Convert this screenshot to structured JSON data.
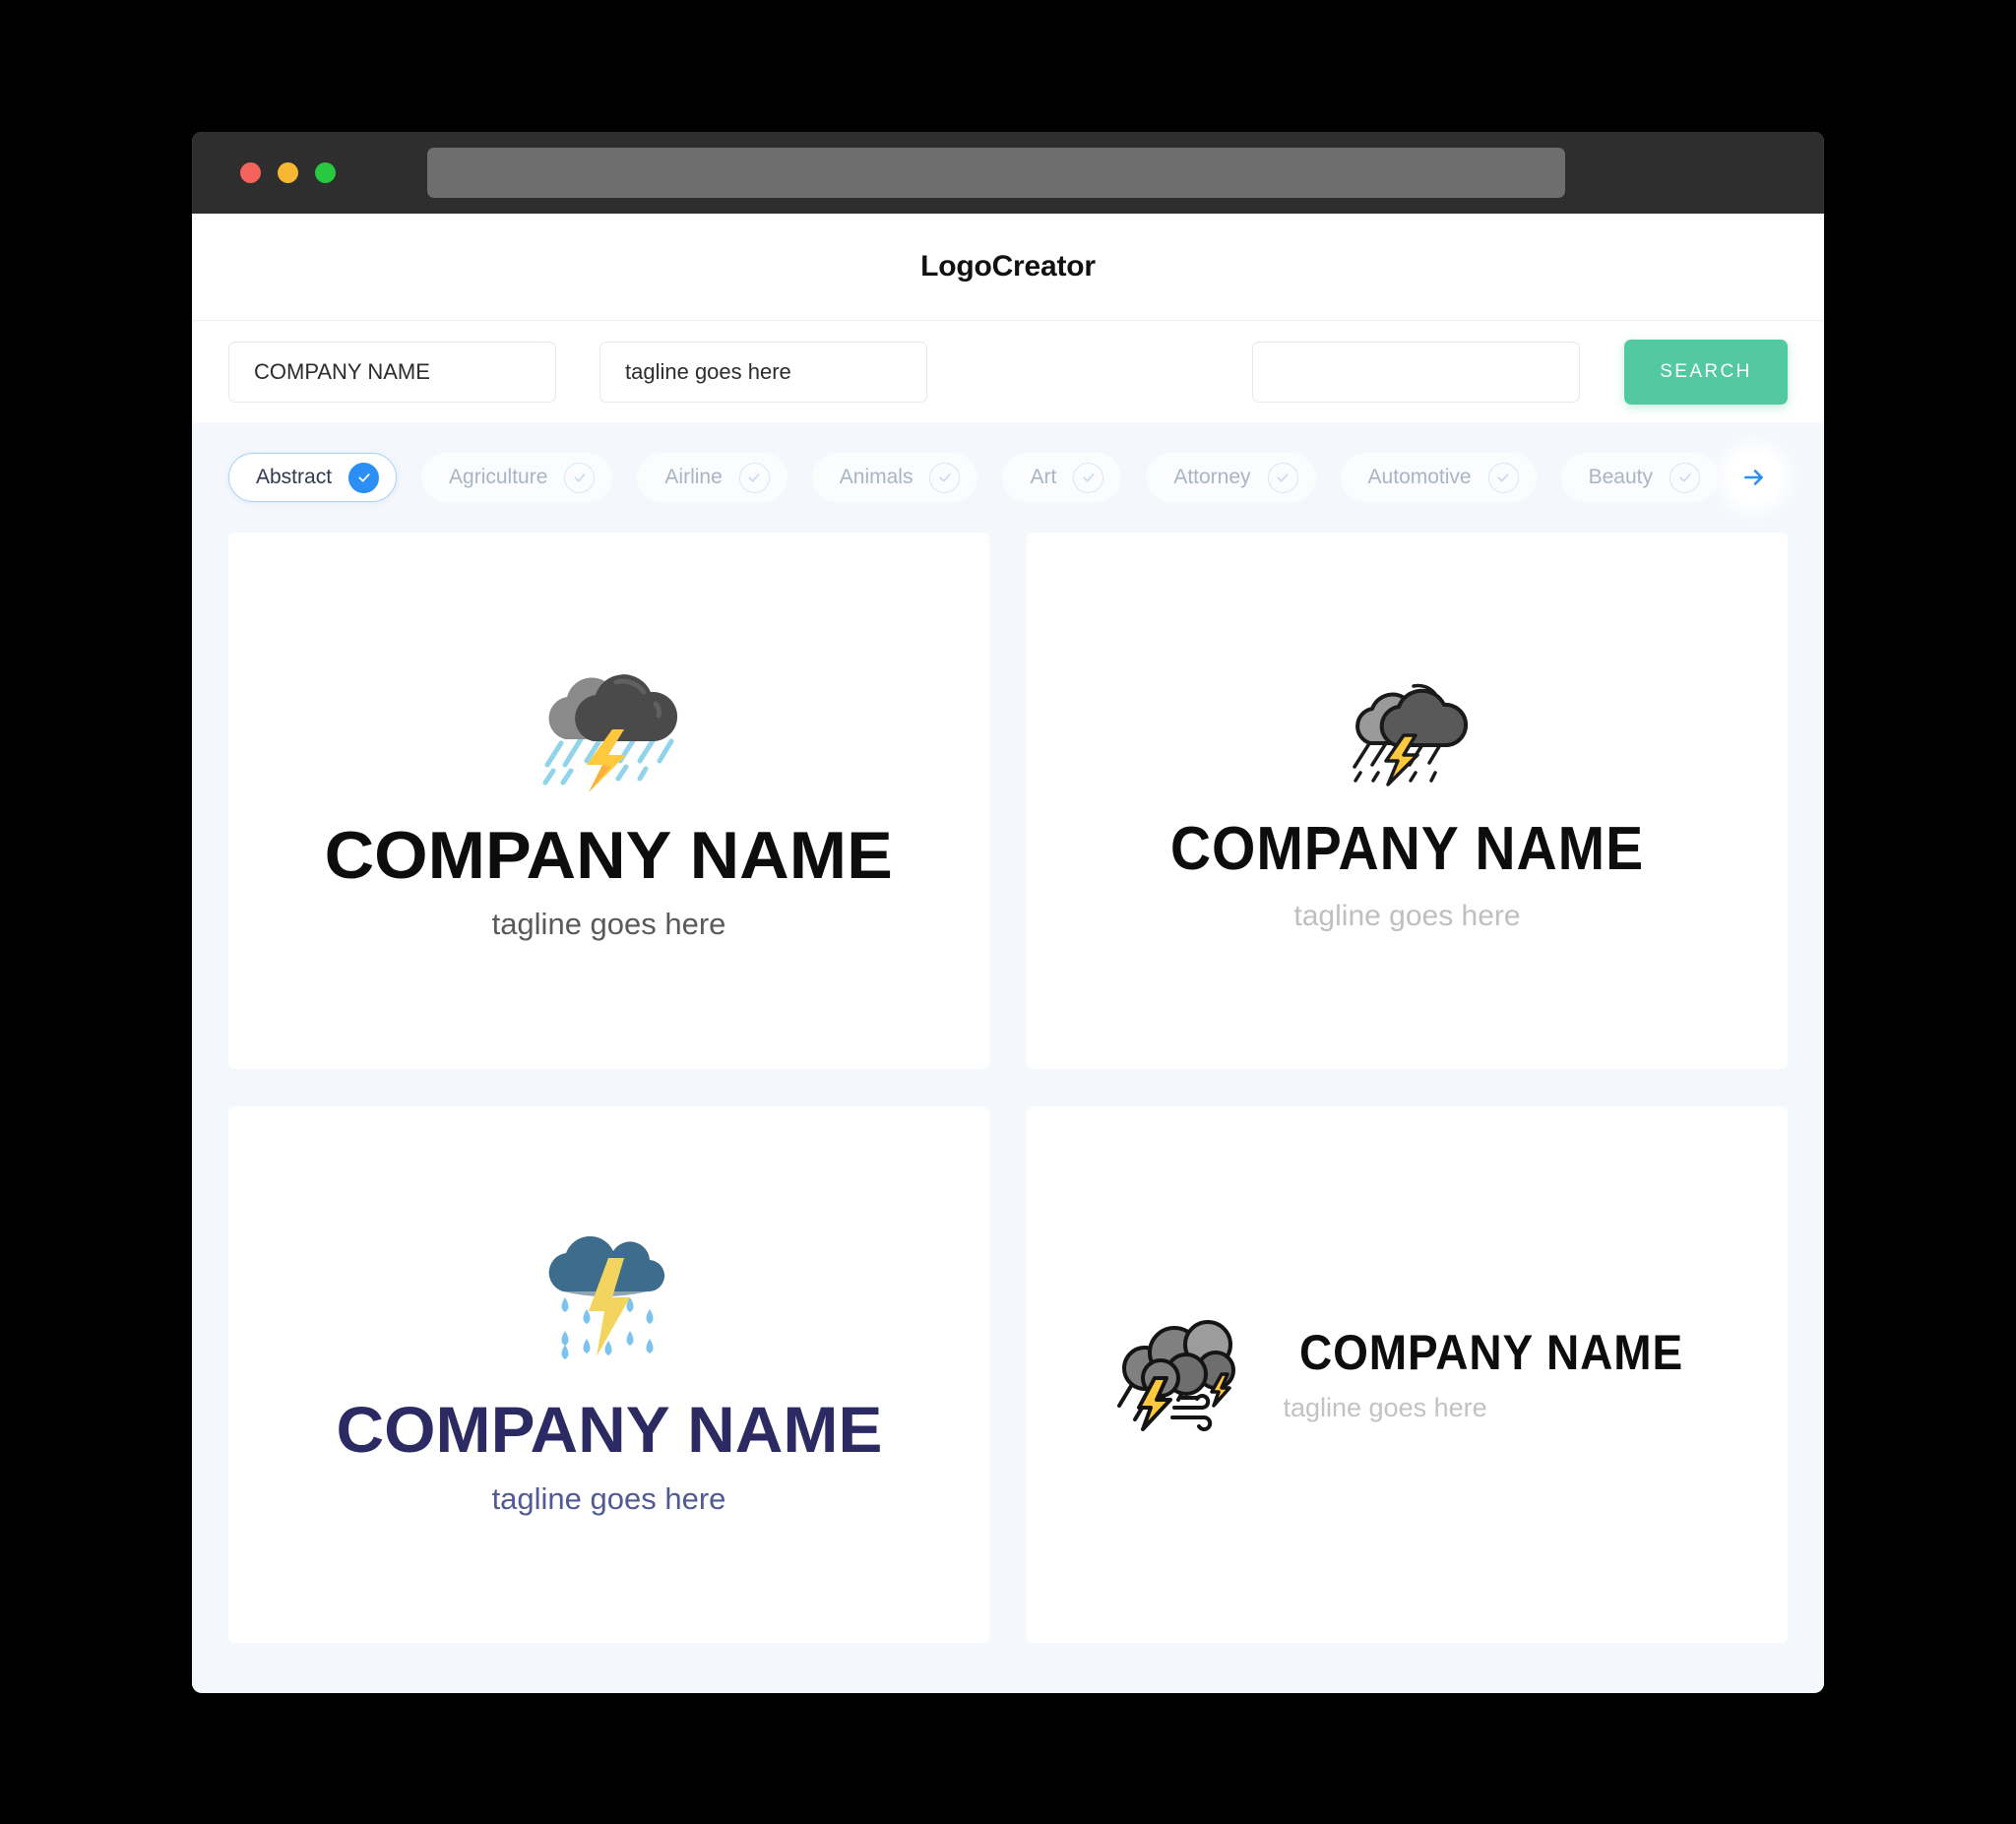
{
  "window": {
    "traffic_lights": [
      {
        "name": "close",
        "color": "#F4635C"
      },
      {
        "name": "minimize",
        "color": "#F7B733"
      },
      {
        "name": "maximize",
        "color": "#28C840"
      }
    ],
    "url_value": ""
  },
  "header": {
    "app_title": "LogoCreator"
  },
  "search": {
    "company_value": "COMPANY NAME",
    "company_placeholder": "COMPANY NAME",
    "tagline_value": "tagline goes here",
    "tagline_placeholder": "tagline goes here",
    "extra_value": "",
    "extra_placeholder": "",
    "search_label": "SEARCH",
    "search_button_color": "#52C9A0"
  },
  "categories": {
    "next_icon": "arrow-right-icon",
    "accent_color": "#2B8FF5",
    "items": [
      {
        "label": "Abstract",
        "selected": true
      },
      {
        "label": "Agriculture",
        "selected": false
      },
      {
        "label": "Airline",
        "selected": false
      },
      {
        "label": "Animals",
        "selected": false
      },
      {
        "label": "Art",
        "selected": false
      },
      {
        "label": "Attorney",
        "selected": false
      },
      {
        "label": "Automotive",
        "selected": false
      },
      {
        "label": "Beauty",
        "selected": false
      }
    ]
  },
  "results": {
    "logos": [
      {
        "id": "logo-1",
        "icon": "storm-cloud-rain-lightning-icon",
        "layout": "stacked",
        "name": "COMPANY NAME",
        "tagline": "tagline goes here",
        "name_color": "#0D0D0D",
        "tagline_color": "#5A5A5A",
        "cloud_color": "#4A4A4A",
        "cloud_light_color": "#8A8A8A",
        "bolt_color": "#FFC83D",
        "rain_color": "#8FD4EA"
      },
      {
        "id": "logo-2",
        "icon": "outlined-storm-cloud-icon",
        "layout": "stacked",
        "name": "COMPANY NAME",
        "tagline": "tagline goes here",
        "name_color": "#0D0D0D",
        "tagline_color": "#BFBFBF",
        "cloud_color": "#595959",
        "cloud_light_color": "#9A9A9A",
        "bolt_color": "#FFC83D",
        "outline_color": "#1A1A1A"
      },
      {
        "id": "logo-3",
        "icon": "blue-rain-cloud-lightning-icon",
        "layout": "stacked",
        "name": "COMPANY NAME",
        "tagline": "tagline goes here",
        "name_color": "#2B2A62",
        "tagline_color": "#515A94",
        "cloud_color": "#3D6C8C",
        "cloud_dark_color": "#2F5B78",
        "bolt_color": "#F3D45E",
        "rain_color": "#7CC3EE"
      },
      {
        "id": "logo-4",
        "icon": "storm-cloud-wind-lightning-icon",
        "layout": "horizontal",
        "name": "COMPANY NAME",
        "tagline": "tagline goes here",
        "name_color": "#0D0D0D",
        "tagline_color": "#C2C2C2",
        "cloud_color": "#808080",
        "cloud_dark_color": "#6E6E6E",
        "cloud_light_color": "#9C9C9C",
        "bolt_color": "#FFC83D",
        "outline_color": "#141414"
      }
    ]
  }
}
